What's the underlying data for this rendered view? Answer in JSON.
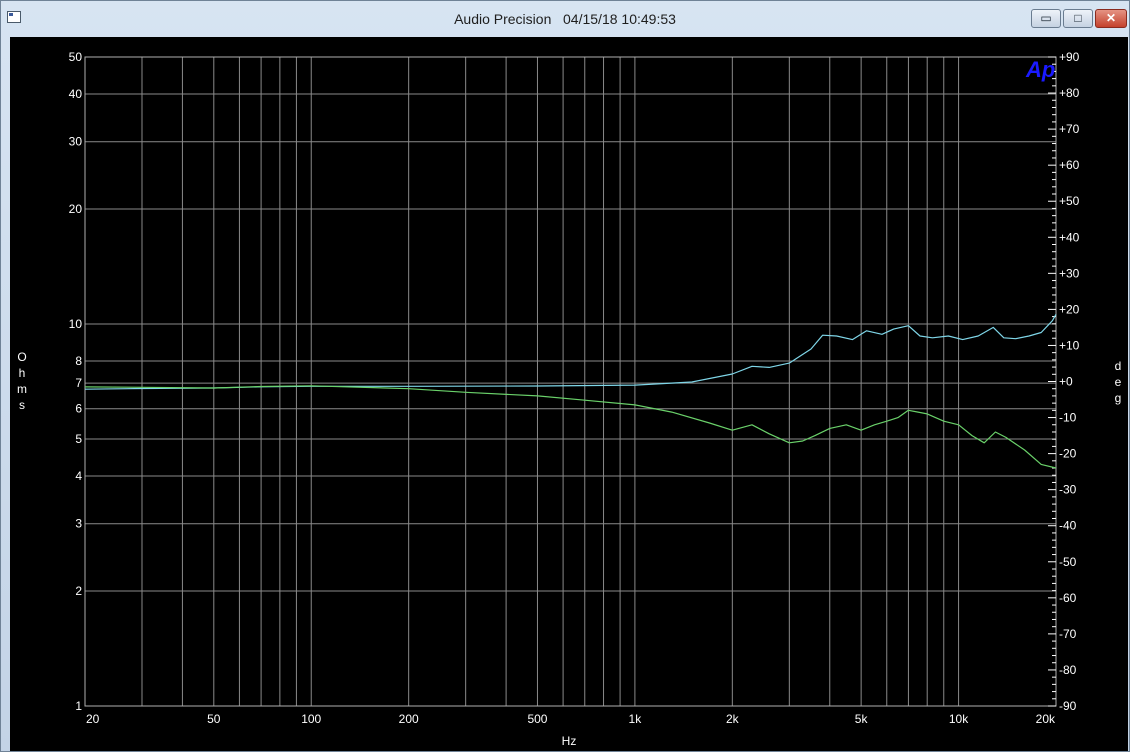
{
  "window": {
    "title": "Audio Precision   04/15/18 10:49:53",
    "controls": {
      "minimize": "▭",
      "maximize": "□",
      "close": "✕"
    }
  },
  "logo": {
    "text": "Ap",
    "color": "#1a1aff"
  },
  "colors": {
    "background": "#000000",
    "grid": "#8a8a8a",
    "text": "#ffffff",
    "impedance": "#7fd6e8",
    "phase": "#6ad16a"
  },
  "chart_data": {
    "type": "line",
    "title": "",
    "xlabel": "Hz",
    "ylabel": "Ohms",
    "y2label": "deg",
    "xscale": "log",
    "xlim": [
      20,
      20000
    ],
    "ylim": [
      1,
      50
    ],
    "yscale": "log",
    "y2lim": [
      -90,
      90
    ],
    "grid": true,
    "x_ticks": [
      20,
      50,
      100,
      200,
      500,
      1000,
      2000,
      5000,
      10000,
      20000
    ],
    "x_tick_labels": [
      "20",
      "50",
      "100",
      "200",
      "500",
      "1k",
      "2k",
      "5k",
      "10k",
      "20k"
    ],
    "y_ticks": [
      1,
      2,
      3,
      4,
      5,
      6,
      7,
      8,
      10,
      20,
      30,
      40,
      50
    ],
    "y_tick_labels": [
      "1",
      "2",
      "3",
      "4",
      "5",
      "6",
      "7",
      "8",
      "10",
      "20",
      "30",
      "40",
      "50"
    ],
    "y2_ticks": [
      90,
      80,
      70,
      60,
      50,
      40,
      30,
      20,
      10,
      0,
      -10,
      -20,
      -30,
      -40,
      -50,
      -60,
      -70,
      -80,
      -90
    ],
    "y2_tick_labels": [
      "+90",
      "+80",
      "+70",
      "+60",
      "+50",
      "+40",
      "+30",
      "+20",
      "+10",
      "+0",
      "-10",
      "-20",
      "-30",
      "-40",
      "-50",
      "-60",
      "-70",
      "-80",
      "-90"
    ],
    "series": [
      {
        "key": "impedance",
        "axis": "left",
        "x": [
          20,
          30,
          50,
          70,
          100,
          200,
          500,
          1000,
          1500,
          2000,
          2300,
          2600,
          3000,
          3500,
          3800,
          4200,
          4700,
          5200,
          5800,
          6300,
          7000,
          7600,
          8300,
          9300,
          10300,
          11500,
          12800,
          13800,
          15000,
          16500,
          18000,
          19500,
          20000
        ],
        "y": [
          6.75,
          6.78,
          6.8,
          6.85,
          6.87,
          6.87,
          6.88,
          6.92,
          7.05,
          7.4,
          7.75,
          7.7,
          7.9,
          8.6,
          9.35,
          9.3,
          9.1,
          9.6,
          9.4,
          9.7,
          9.9,
          9.3,
          9.2,
          9.3,
          9.1,
          9.3,
          9.8,
          9.2,
          9.15,
          9.3,
          9.5,
          10.2,
          10.6
        ]
      },
      {
        "key": "phase",
        "axis": "right",
        "x": [
          20,
          30,
          50,
          70,
          100,
          200,
          300,
          500,
          700,
          1000,
          1300,
          1700,
          2000,
          2300,
          2600,
          3000,
          3300,
          3600,
          4000,
          4500,
          5000,
          5500,
          6000,
          6500,
          7000,
          7500,
          8000,
          9000,
          10000,
          11000,
          12000,
          13000,
          14000,
          16000,
          18000,
          20000
        ],
        "y": [
          -1.5,
          -1.6,
          -1.8,
          -1.4,
          -1.2,
          -2.0,
          -3.0,
          -4.0,
          -5.2,
          -6.5,
          -8.5,
          -11.5,
          -13.5,
          -12.0,
          -14.5,
          -17.0,
          -16.5,
          -15.0,
          -13.0,
          -12.0,
          -13.5,
          -12.0,
          -11.0,
          -10.0,
          -8.0,
          -8.5,
          -9.0,
          -11.0,
          -12.0,
          -15.0,
          -17.0,
          -14.0,
          -15.5,
          -19.0,
          -23.0,
          -24.0
        ]
      }
    ]
  }
}
